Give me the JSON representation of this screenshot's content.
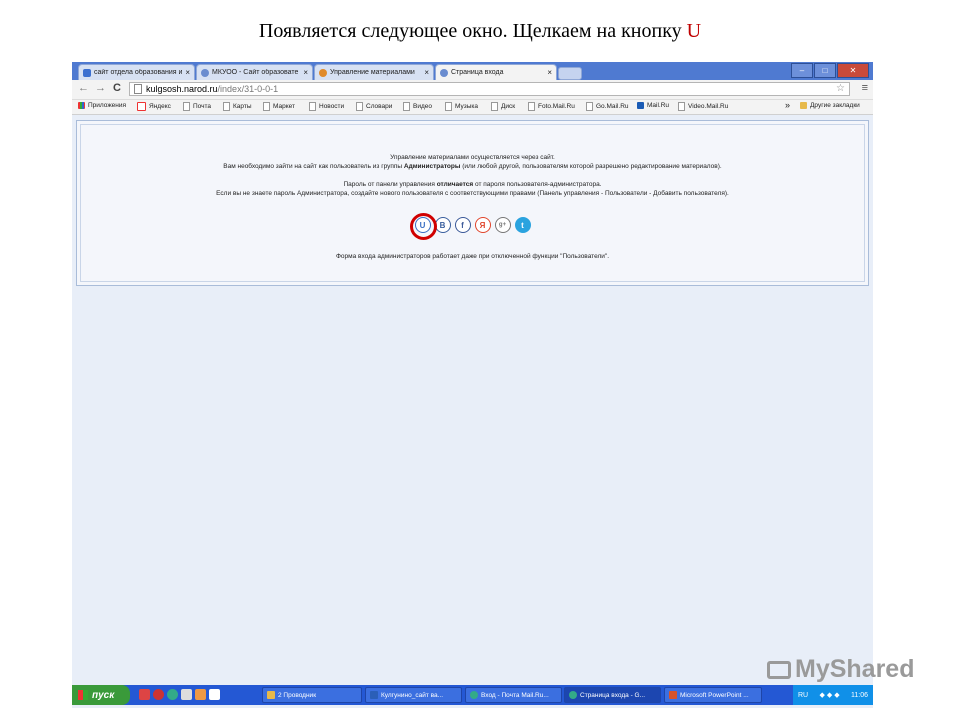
{
  "slide": {
    "caption": "Появляется следующее окно. Щелкаем на кнопку",
    "caption_key": "U"
  },
  "tabs": [
    {
      "label": "сайт отдела образования и",
      "color": "#3b6fd0"
    },
    {
      "label": "МКУОО - Сайт образовате",
      "color": "#6a8ccf"
    },
    {
      "label": "Управление материалами",
      "color": "#e08a2a"
    },
    {
      "label": "Страница входа",
      "color": "#6a8ccf"
    }
  ],
  "toolbar": {
    "back": "←",
    "forward": "→",
    "reload": "C",
    "url_host": "kulgsosh.narod.ru",
    "url_path": "/index/31-0-0-1",
    "star": "☆",
    "menu": "≡"
  },
  "bookmarks": {
    "items": [
      "Приложения",
      "Яндекс",
      "Почта",
      "Карты",
      "Маркет",
      "Новости",
      "Словари",
      "Видео",
      "Музыка",
      "Диск",
      "Foto.Mail.Ru",
      "Go.Mail.Ru",
      "Mail.Ru",
      "Video.Mail.Ru"
    ],
    "more": "»",
    "other": "Другие закладки"
  },
  "page": {
    "line1": "Управление материалами осуществляется через сайт.",
    "line2_a": "Вам необходимо зайти на сайт как пользователь из группы ",
    "line2_b": "Администраторы",
    "line2_c": " (или любой другой, пользователям которой разрешено редактирование материалов).",
    "line3_a": "Пароль от панели управления ",
    "line3_b": "отличается",
    "line3_c": " от пароля пользователя-администратора.",
    "line4": "Если вы не знаете пароль Администратора, создайте нового пользователя с соответствующими правами (Панель управления - Пользователи - Добавить пользователя).",
    "footer": "Форма входа администраторов работает даже при отключенной функции \"Пользователи\"."
  },
  "social": [
    {
      "glyph": "U",
      "color": "#3a6fc4"
    },
    {
      "glyph": "B",
      "color": "#3a5f9e"
    },
    {
      "glyph": "f",
      "color": "#3b5998"
    },
    {
      "glyph": "Я",
      "color": "#e0452c"
    },
    {
      "glyph": "g+",
      "color": "#777777"
    },
    {
      "glyph": "t",
      "color": "#2aa3df"
    }
  ],
  "taskbar": {
    "start": "пуск",
    "tasks": [
      "2 Проводник",
      "Кулгунино_сайт ва...",
      "Вход - Почта Mail.Ru...",
      "Страница входа - G...",
      "Microsoft PowerPoint ..."
    ],
    "lang": "RU",
    "time": "11:06"
  },
  "watermark": "MyShared"
}
